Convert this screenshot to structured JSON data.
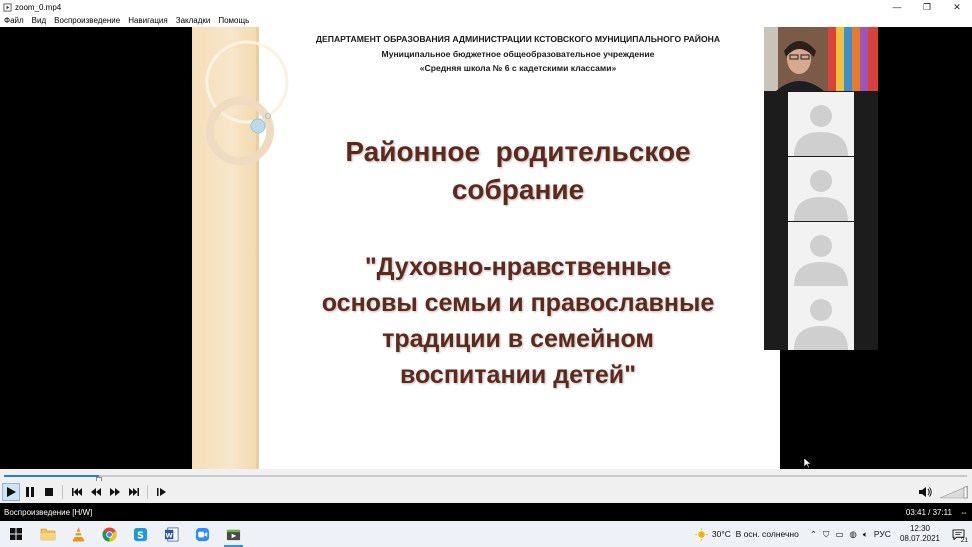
{
  "window": {
    "title": "zoom_0.mp4",
    "controls": {
      "minimize": "—",
      "restore": "❐",
      "close": "✕"
    }
  },
  "menu": [
    "Файл",
    "Вид",
    "Воспроизведение",
    "Навигация",
    "Закладки",
    "Помощь"
  ],
  "slide": {
    "header": [
      "ДЕПАРТАМЕНТ ОБРАЗОВАНИЯ АДМИНИСТРАЦИИ КСТОВСКОГО МУНИЦИПАЛЬНОГО РАЙОНА",
      "Муниципальное бюджетное общеобразовательное учреждение",
      "«Средняя школа № 6 с кадетскими классами»"
    ],
    "title": [
      "Районное  родительское",
      "собрание"
    ],
    "subtitle": [
      "\"Духовно-нравственные",
      "основы семьи и православные",
      "традиции в семейном",
      "воспитании детей\""
    ]
  },
  "participants": {
    "tiles": 4
  },
  "player": {
    "progress": 0.0987,
    "status": "Воспроизведение [H/W]",
    "time": "03:41 / 37:11"
  },
  "taskbar": {
    "apps": [
      "windows-start",
      "file-explorer",
      "vlc",
      "chrome",
      "skype",
      "word",
      "zoom",
      "media-player"
    ],
    "weather": "30°C  В осн. солнечно",
    "language": "РУС",
    "clock_time": "12:30",
    "clock_date": "08.07.2021",
    "notifications": "21"
  },
  "colors": {
    "title_text": "#5a2a1f",
    "accent": "#2e7cd6",
    "band": "#f5dfba"
  }
}
